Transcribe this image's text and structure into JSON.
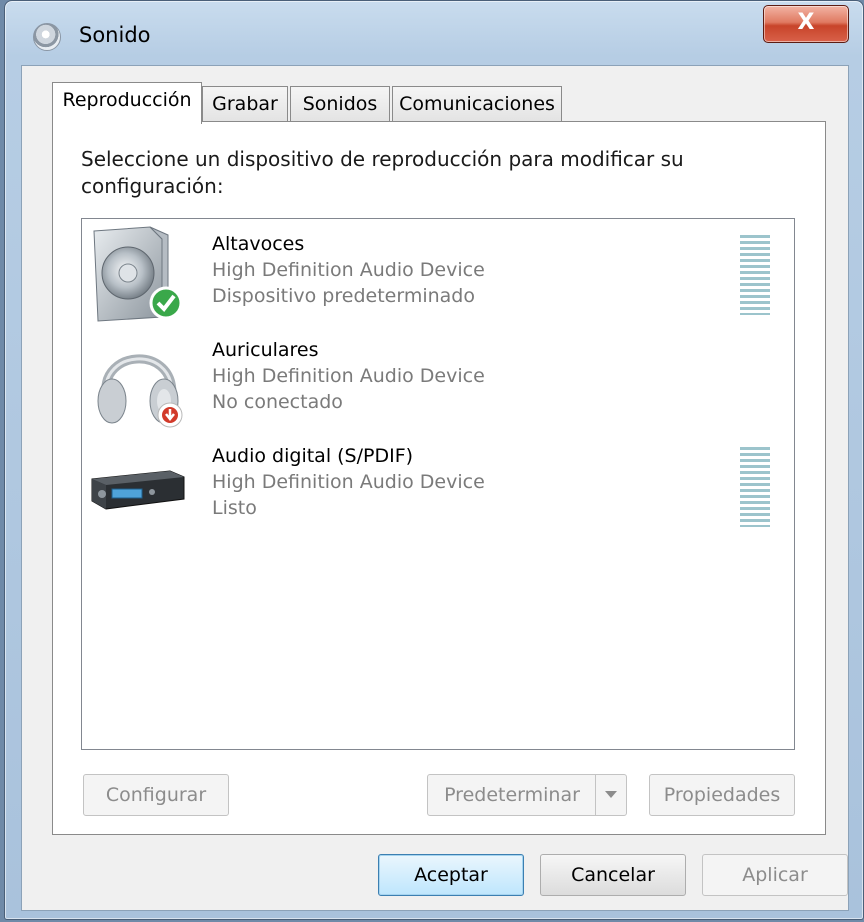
{
  "window": {
    "title": "Sonido",
    "close_label": "X"
  },
  "tabs": [
    {
      "label": "Reproducción",
      "active": true
    },
    {
      "label": "Grabar",
      "active": false
    },
    {
      "label": "Sonidos",
      "active": false
    },
    {
      "label": "Comunicaciones",
      "active": false
    }
  ],
  "instruction": "Seleccione un dispositivo de reproducción para modificar su configuración:",
  "devices": [
    {
      "name": "Altavoces",
      "driver": "High Definition Audio Device",
      "status": "Dispositivo predeterminado",
      "icon": "speaker-icon",
      "badge": "default-check-icon"
    },
    {
      "name": "Auriculares",
      "driver": "High Definition Audio Device",
      "status": "No conectado",
      "icon": "headphones-icon",
      "badge": "disconnected-icon"
    },
    {
      "name": "Audio digital (S/PDIF)",
      "driver": "High Definition Audio Device",
      "status": "Listo",
      "icon": "digital-audio-receiver-icon"
    }
  ],
  "buttons": {
    "configure": "Configurar",
    "set_default": "Predeterminar",
    "properties": "Propiedades",
    "ok": "Aceptar",
    "cancel": "Cancelar",
    "apply": "Aplicar"
  },
  "colors": {
    "meter": "#9cc4cc",
    "check": "#3aa84a",
    "disconnected": "#d23a2a"
  }
}
